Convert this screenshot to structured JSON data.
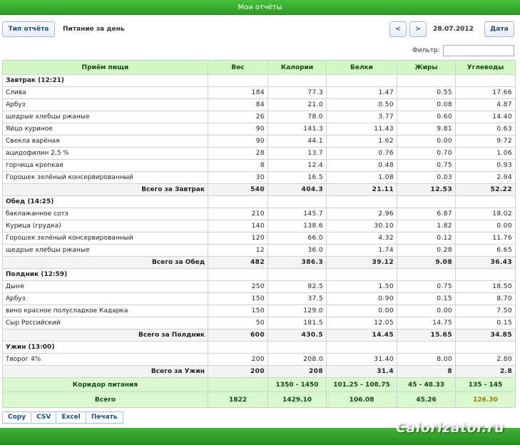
{
  "title": "Мои отчёты",
  "toolbar": {
    "report_type": "Тип отчёта",
    "report_name": "Питание за день",
    "prev": "<",
    "next": ">",
    "date": "28.07.2012",
    "date_button": "Дата",
    "filter_label": "Фильтр:",
    "filter_value": ""
  },
  "table": {
    "headers": [
      "Приём пищи",
      "Вес",
      "Калории",
      "Белки",
      "Жиры",
      "Углеводы"
    ],
    "meals": [
      {
        "name": "Завтрак (12:21)",
        "items": [
          [
            "Слива",
            "184",
            "77.3",
            "1.47",
            "0.55",
            "17.66"
          ],
          [
            "Арбуз",
            "84",
            "21.0",
            "0.50",
            "0.08",
            "4.87"
          ],
          [
            "щедрые хлебцы ржаные",
            "26",
            "78.0",
            "3.77",
            "0.60",
            "14.40"
          ],
          [
            "Яйцо куриное",
            "90",
            "141.3",
            "11.43",
            "9.81",
            "0.63"
          ],
          [
            "Свекла варёная",
            "90",
            "44.1",
            "1.62",
            "0.00",
            "9.72"
          ],
          [
            "ацидофилин 2,5 %",
            "28",
            "13.7",
            "0.76",
            "0.70",
            "1.06"
          ],
          [
            "горчица крепкая",
            "8",
            "12.4",
            "0.48",
            "0.75",
            "0.93"
          ],
          [
            "Горошек зелёный консервированный",
            "30",
            "16.5",
            "1.08",
            "0.03",
            "2.94"
          ]
        ],
        "total": [
          "Всего за Завтрак",
          "540",
          "404.3",
          "21.11",
          "12.53",
          "52.22"
        ]
      },
      {
        "name": "Обед (14:25)",
        "items": [
          [
            "баклажанное сотэ",
            "210",
            "145.7",
            "2.96",
            "6.87",
            "18.02"
          ],
          [
            "Курица (грудка)",
            "140",
            "138.6",
            "30.10",
            "1.82",
            "0.00"
          ],
          [
            "Горошек зелёный консервированный",
            "120",
            "66.0",
            "4.32",
            "0.12",
            "11.76"
          ],
          [
            "щедрые хлебцы ржаные",
            "12",
            "36.0",
            "1.74",
            "0.28",
            "6.65"
          ]
        ],
        "total": [
          "Всего за Обед",
          "482",
          "386.3",
          "39.12",
          "9.08",
          "36.43"
        ]
      },
      {
        "name": "Полдник (12:59)",
        "items": [
          [
            "Дыня",
            "250",
            "82.5",
            "1.50",
            "0.75",
            "18.50"
          ],
          [
            "Арбуз",
            "150",
            "37.5",
            "0.90",
            "0.15",
            "8.70"
          ],
          [
            "вино красное полусладкое Кадарка",
            "150",
            "129.0",
            "0.00",
            "0.00",
            "7.50"
          ],
          [
            "Сыр Российский",
            "50",
            "181.5",
            "12.05",
            "14.75",
            "0.15"
          ]
        ],
        "total": [
          "Всего за Полдник",
          "600",
          "430.5",
          "14.45",
          "15.65",
          "34.85"
        ]
      },
      {
        "name": "Ужин (13:00)",
        "items": [
          [
            "Творог 4%",
            "200",
            "208.0",
            "31.40",
            "8.00",
            "2.80"
          ]
        ],
        "total": [
          "Всего за Ужин",
          "200",
          "208",
          "31.4",
          "8",
          "2.8"
        ]
      }
    ],
    "corridor": [
      "Коридор питания",
      "",
      "1350 - 1450",
      "101.25 - 108.75",
      "45 - 48.33",
      "135 - 145"
    ],
    "grand_total": [
      "Всего",
      "1822",
      "1429.10",
      "106.08",
      "45.26",
      "126.30"
    ]
  },
  "export_buttons": [
    "Copy",
    "CSV",
    "Excel",
    "Печать"
  ],
  "watermark": "Calorizator.ru",
  "colors": {
    "header_green": "#2e9a26",
    "table_header_bg": "#d2f8c6",
    "link_blue": "#1a4d8c",
    "highlight": "#a07a00"
  }
}
